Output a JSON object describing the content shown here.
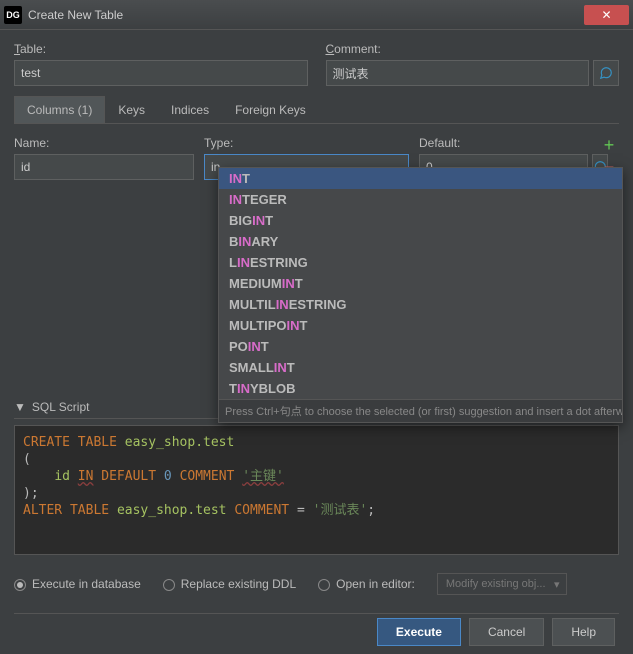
{
  "window": {
    "title": "Create New Table"
  },
  "form": {
    "table_label": "Table:",
    "table_value": "test",
    "comment_label": "Comment:",
    "comment_value": "测试表"
  },
  "tabs": {
    "columns": "Columns (1)",
    "keys": "Keys",
    "indices": "Indices",
    "foreign": "Foreign Keys"
  },
  "fields": {
    "name_label": "Name:",
    "type_label": "Type:",
    "default_label": "Default:",
    "name_value": "id",
    "type_value": "in",
    "default_value": "0"
  },
  "autocomplete": {
    "items": [
      "INT",
      "INTEGER",
      "BIGINT",
      "BINARY",
      "LINESTRING",
      "MEDIUMINT",
      "MULTILINESTRING",
      "MULTIPOINT",
      "POINT",
      "SMALLINT",
      "TINYBLOB"
    ],
    "highlight": "IN",
    "hint": "Press Ctrl+句点 to choose the selected (or first) suggestion and insert a dot afterwards"
  },
  "sql": {
    "header": "SQL Script",
    "l1a": "CREATE",
    "l1b": "TABLE",
    "l1c": "easy_shop.test",
    "l2": "(",
    "l3a": "id",
    "l3b": "IN",
    "l3c": "DEFAULT",
    "l3d": "0",
    "l3e": "COMMENT",
    "l3f": "'主键'",
    "l4": ");",
    "l5a": "ALTER",
    "l5b": "TABLE",
    "l5c": "easy_shop.test",
    "l5d": "COMMENT",
    "l5e": " = ",
    "l5f": "'测试表'",
    "l5g": ";"
  },
  "opts": {
    "exec": "Execute in database",
    "replace": "Replace existing DDL",
    "open": "Open in editor:",
    "modify": "Modify existing obj..."
  },
  "buttons": {
    "execute": "Execute",
    "cancel": "Cancel",
    "help": "Help"
  }
}
